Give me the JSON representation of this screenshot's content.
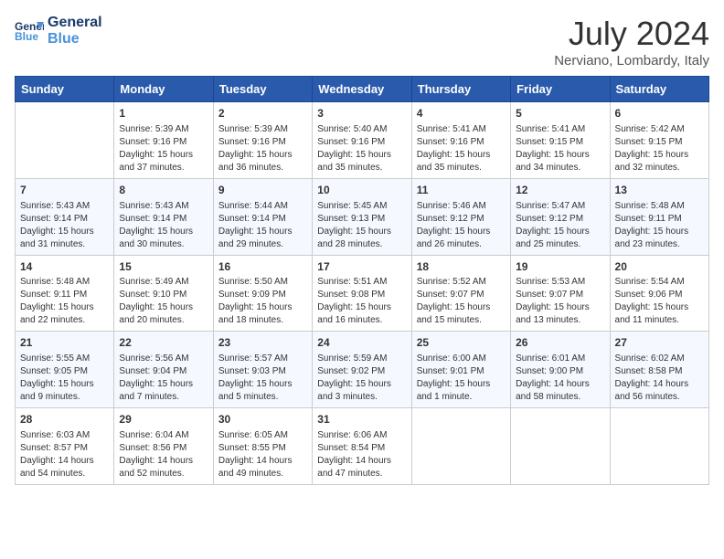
{
  "logo": {
    "line1": "General",
    "line2": "Blue"
  },
  "title": "July 2024",
  "location": "Nerviano, Lombardy, Italy",
  "days_of_week": [
    "Sunday",
    "Monday",
    "Tuesday",
    "Wednesday",
    "Thursday",
    "Friday",
    "Saturday"
  ],
  "weeks": [
    [
      {
        "day": "",
        "info": ""
      },
      {
        "day": "1",
        "info": "Sunrise: 5:39 AM\nSunset: 9:16 PM\nDaylight: 15 hours\nand 37 minutes."
      },
      {
        "day": "2",
        "info": "Sunrise: 5:39 AM\nSunset: 9:16 PM\nDaylight: 15 hours\nand 36 minutes."
      },
      {
        "day": "3",
        "info": "Sunrise: 5:40 AM\nSunset: 9:16 PM\nDaylight: 15 hours\nand 35 minutes."
      },
      {
        "day": "4",
        "info": "Sunrise: 5:41 AM\nSunset: 9:16 PM\nDaylight: 15 hours\nand 35 minutes."
      },
      {
        "day": "5",
        "info": "Sunrise: 5:41 AM\nSunset: 9:15 PM\nDaylight: 15 hours\nand 34 minutes."
      },
      {
        "day": "6",
        "info": "Sunrise: 5:42 AM\nSunset: 9:15 PM\nDaylight: 15 hours\nand 32 minutes."
      }
    ],
    [
      {
        "day": "7",
        "info": "Sunrise: 5:43 AM\nSunset: 9:14 PM\nDaylight: 15 hours\nand 31 minutes."
      },
      {
        "day": "8",
        "info": "Sunrise: 5:43 AM\nSunset: 9:14 PM\nDaylight: 15 hours\nand 30 minutes."
      },
      {
        "day": "9",
        "info": "Sunrise: 5:44 AM\nSunset: 9:14 PM\nDaylight: 15 hours\nand 29 minutes."
      },
      {
        "day": "10",
        "info": "Sunrise: 5:45 AM\nSunset: 9:13 PM\nDaylight: 15 hours\nand 28 minutes."
      },
      {
        "day": "11",
        "info": "Sunrise: 5:46 AM\nSunset: 9:12 PM\nDaylight: 15 hours\nand 26 minutes."
      },
      {
        "day": "12",
        "info": "Sunrise: 5:47 AM\nSunset: 9:12 PM\nDaylight: 15 hours\nand 25 minutes."
      },
      {
        "day": "13",
        "info": "Sunrise: 5:48 AM\nSunset: 9:11 PM\nDaylight: 15 hours\nand 23 minutes."
      }
    ],
    [
      {
        "day": "14",
        "info": "Sunrise: 5:48 AM\nSunset: 9:11 PM\nDaylight: 15 hours\nand 22 minutes."
      },
      {
        "day": "15",
        "info": "Sunrise: 5:49 AM\nSunset: 9:10 PM\nDaylight: 15 hours\nand 20 minutes."
      },
      {
        "day": "16",
        "info": "Sunrise: 5:50 AM\nSunset: 9:09 PM\nDaylight: 15 hours\nand 18 minutes."
      },
      {
        "day": "17",
        "info": "Sunrise: 5:51 AM\nSunset: 9:08 PM\nDaylight: 15 hours\nand 16 minutes."
      },
      {
        "day": "18",
        "info": "Sunrise: 5:52 AM\nSunset: 9:07 PM\nDaylight: 15 hours\nand 15 minutes."
      },
      {
        "day": "19",
        "info": "Sunrise: 5:53 AM\nSunset: 9:07 PM\nDaylight: 15 hours\nand 13 minutes."
      },
      {
        "day": "20",
        "info": "Sunrise: 5:54 AM\nSunset: 9:06 PM\nDaylight: 15 hours\nand 11 minutes."
      }
    ],
    [
      {
        "day": "21",
        "info": "Sunrise: 5:55 AM\nSunset: 9:05 PM\nDaylight: 15 hours\nand 9 minutes."
      },
      {
        "day": "22",
        "info": "Sunrise: 5:56 AM\nSunset: 9:04 PM\nDaylight: 15 hours\nand 7 minutes."
      },
      {
        "day": "23",
        "info": "Sunrise: 5:57 AM\nSunset: 9:03 PM\nDaylight: 15 hours\nand 5 minutes."
      },
      {
        "day": "24",
        "info": "Sunrise: 5:59 AM\nSunset: 9:02 PM\nDaylight: 15 hours\nand 3 minutes."
      },
      {
        "day": "25",
        "info": "Sunrise: 6:00 AM\nSunset: 9:01 PM\nDaylight: 15 hours\nand 1 minute."
      },
      {
        "day": "26",
        "info": "Sunrise: 6:01 AM\nSunset: 9:00 PM\nDaylight: 14 hours\nand 58 minutes."
      },
      {
        "day": "27",
        "info": "Sunrise: 6:02 AM\nSunset: 8:58 PM\nDaylight: 14 hours\nand 56 minutes."
      }
    ],
    [
      {
        "day": "28",
        "info": "Sunrise: 6:03 AM\nSunset: 8:57 PM\nDaylight: 14 hours\nand 54 minutes."
      },
      {
        "day": "29",
        "info": "Sunrise: 6:04 AM\nSunset: 8:56 PM\nDaylight: 14 hours\nand 52 minutes."
      },
      {
        "day": "30",
        "info": "Sunrise: 6:05 AM\nSunset: 8:55 PM\nDaylight: 14 hours\nand 49 minutes."
      },
      {
        "day": "31",
        "info": "Sunrise: 6:06 AM\nSunset: 8:54 PM\nDaylight: 14 hours\nand 47 minutes."
      },
      {
        "day": "",
        "info": ""
      },
      {
        "day": "",
        "info": ""
      },
      {
        "day": "",
        "info": ""
      }
    ]
  ]
}
